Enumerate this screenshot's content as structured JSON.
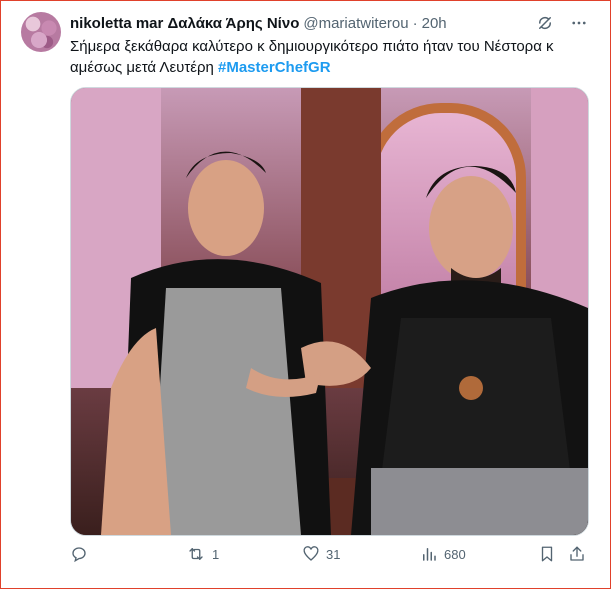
{
  "tweet": {
    "display_name": "nikoletta mar Δαλάκα Άρης Νίνο",
    "handle": "@mariatwiterou",
    "separator": "·",
    "time": "20h",
    "text_main": "Σήμερα ξεκάθαρα καλύτερο κ δημιουργικότερο πιάτο ήταν του Νέστορα κ αμέσως μετά Λευτέρη ",
    "hashtag": "#MasterChefGR"
  },
  "actions": {
    "reply_count": "",
    "retweet_count": "1",
    "like_count": "31",
    "views_count": "680"
  },
  "icons": {
    "grok": "grok-icon",
    "more": "more-icon",
    "reply": "reply-icon",
    "retweet": "retweet-icon",
    "like": "like-icon",
    "views": "views-icon",
    "bookmark": "bookmark-icon",
    "share": "share-icon"
  },
  "colors": {
    "accent": "#1d9bf0",
    "secondary_text": "#536471",
    "frame": "#e0412b"
  }
}
